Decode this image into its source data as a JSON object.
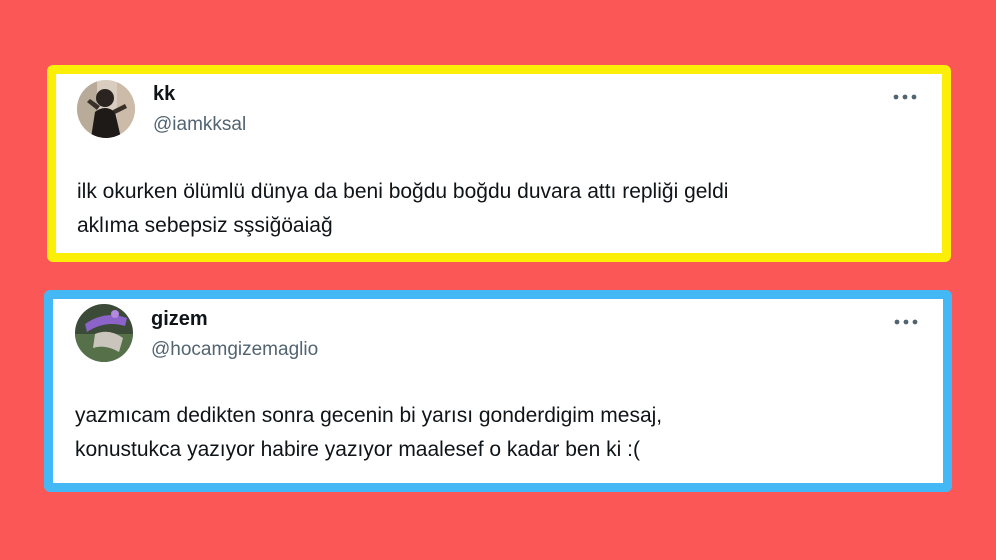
{
  "colors": {
    "background": "#fb5757",
    "card1_border": "#fbee07",
    "card2_border": "#43b8f5",
    "handle_gray": "#536471"
  },
  "tweets": [
    {
      "display_name": "kk",
      "handle": "@iamkksal",
      "avatar_icon": "profile-photo",
      "more_icon": "more-options-icon",
      "text_lines": [
        "ilk okurken ölümlü dünya da beni boğdu boğdu duvara attı repliği geldi",
        "aklıma sebepsiz sşsiğöaiağ"
      ]
    },
    {
      "display_name": "gizem",
      "handle": "@hocamgizemaglio",
      "avatar_icon": "profile-photo",
      "more_icon": "more-options-icon",
      "text_lines": [
        "yazmıcam dedikten sonra gecenin bi yarısı gonderdigim mesaj,",
        "konustukca yazıyor habire yazıyor maalesef o kadar ben ki :("
      ]
    }
  ]
}
